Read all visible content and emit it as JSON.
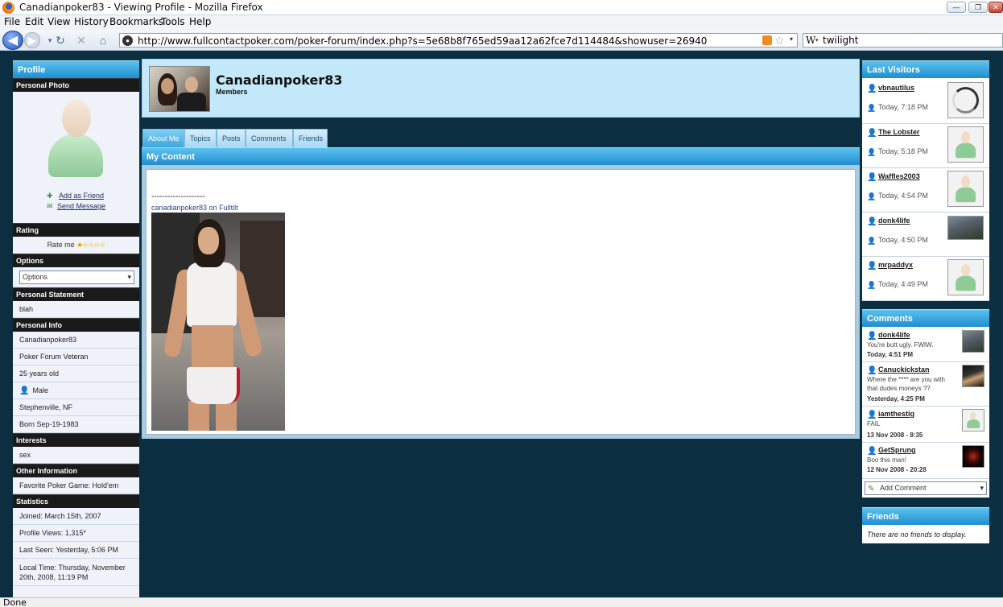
{
  "browser": {
    "window_title": "Canadianpoker83 - Viewing Profile - Mozilla Firefox",
    "menu": [
      "File",
      "Edit",
      "View",
      "History",
      "Bookmarks",
      "Tools",
      "Help"
    ],
    "url": "http://www.fullcontactpoker.com/poker-forum/index.php?s=5e68b8f765ed59aa12a62fce7d114484&showuser=26940",
    "search_engine_icon": "W",
    "search_value": "twilight",
    "status": "Done"
  },
  "left": {
    "profile_header": "Profile",
    "personal_photo_header": "Personal Photo",
    "add_friend": "Add as Friend",
    "send_message": "Send Message",
    "rating_header": "Rating",
    "rate_label": "Rate me",
    "rate_stars": "★☆☆☆☆",
    "options_header": "Options",
    "options_value": "Options",
    "statement_header": "Personal Statement",
    "statement": "blah",
    "info_header": "Personal Info",
    "info": {
      "name": "Canadianpoker83",
      "title": "Poker Forum Veteran",
      "age": "25 years old",
      "gender": "Male",
      "location": "Stephenville, NF",
      "born": "Born Sep-19-1983"
    },
    "interests_header": "Interests",
    "interests": "sex",
    "other_header": "Other Information",
    "other": "Favorite Poker Game: Hold'em",
    "stats_header": "Statistics",
    "stats": {
      "joined": "Joined: March 15th, 2007",
      "views": "Profile Views: 1,315*",
      "last_seen": "Last Seen: Yesterday, 5:06 PM",
      "local_time": "Local Time: Thursday, November 20th, 2008, 11:19 PM"
    }
  },
  "center": {
    "username": "Canadianpoker83",
    "group": "Members",
    "tabs": [
      "About Me",
      "Topics",
      "Posts",
      "Comments",
      "Friends"
    ],
    "content_header": "My Content",
    "dashes": "--------------------",
    "signature_link": "canadianpoker83 on Fulltilt"
  },
  "right": {
    "visitors_header": "Last Visitors",
    "visitors": [
      {
        "name": "vbnautilus",
        "time": "Today, 7:18 PM"
      },
      {
        "name": "The Lobster",
        "time": "Today, 5:18 PM"
      },
      {
        "name": "Waffles2003",
        "time": "Today, 4:54 PM"
      },
      {
        "name": "donk4life",
        "time": "Today, 4:50 PM"
      },
      {
        "name": "mrpaddyx",
        "time": "Today, 4:49 PM"
      }
    ],
    "comments_header": "Comments",
    "comments": [
      {
        "name": "donk4life",
        "text": "You're butt ugly. FWIW.",
        "date": "Today, 4:51 PM"
      },
      {
        "name": "Canuckickstan",
        "text": "Where the **** are you with that dudes moneys ??",
        "date": "Yesterday, 4:25 PM"
      },
      {
        "name": "iamthestig",
        "text": "FAIL",
        "date": "13 Nov 2008 - 8:35"
      },
      {
        "name": "GetSprung",
        "text": "Boo this man!",
        "date": "12 Nov 2008 - 20:28"
      }
    ],
    "add_comment": "Add Comment",
    "friends_header": "Friends",
    "friends_empty": "There are no friends to display."
  }
}
